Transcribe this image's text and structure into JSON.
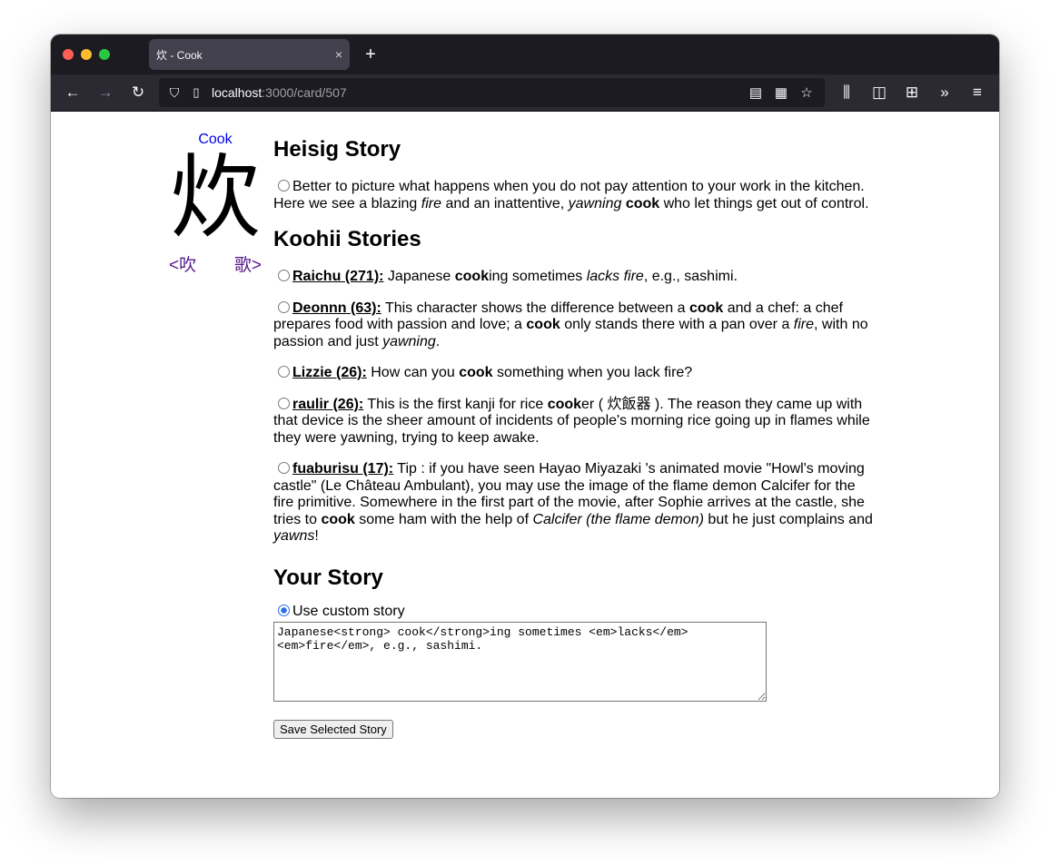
{
  "browser": {
    "tab_title": "炊 - Cook",
    "tab_close": "×",
    "new_tab": "+",
    "url_host": "localhost",
    "url_path": ":3000/card/507",
    "icons": {
      "back": "←",
      "forward": "→",
      "reload": "↻",
      "shield": "⛉",
      "page": "▯",
      "reader": "▤",
      "qr": "▦",
      "bookmark": "☆",
      "library": "⫼",
      "sidebar": "◫",
      "extensions": "⊞",
      "overflow": "»",
      "menu": "≡"
    }
  },
  "card": {
    "keyword": "Cook",
    "kanji": "炊",
    "prev_label": "<吹",
    "next_label": "歌>"
  },
  "heisig": {
    "heading": "Heisig Story",
    "story_parts": [
      {
        "t": "Better to picture what happens when you do not pay attention to your work in the kitchen. Here we see a blazing "
      },
      {
        "t": "fire",
        "em": true
      },
      {
        "t": " and an inattentive, "
      },
      {
        "t": "yawning",
        "em": true
      },
      {
        "t": " "
      },
      {
        "t": "cook",
        "strong": true
      },
      {
        "t": " who let things get out of control."
      }
    ]
  },
  "koohii": {
    "heading": "Koohii Stories",
    "stories": [
      {
        "author": "Raichu (271):",
        "parts": [
          {
            "t": " Japanese "
          },
          {
            "t": "cook",
            "strong": true
          },
          {
            "t": "ing sometimes "
          },
          {
            "t": "lacks fire",
            "em": true
          },
          {
            "t": ", e.g., sashimi."
          }
        ]
      },
      {
        "author": "Deonnn (63):",
        "parts": [
          {
            "t": " This character shows the difference between a "
          },
          {
            "t": "cook",
            "strong": true
          },
          {
            "t": " and a chef: a chef prepares food with passion and love; a "
          },
          {
            "t": "cook",
            "strong": true
          },
          {
            "t": " only stands there with a pan over a "
          },
          {
            "t": "fire",
            "em": true
          },
          {
            "t": ", with no passion and just "
          },
          {
            "t": "yawning",
            "em": true
          },
          {
            "t": "."
          }
        ]
      },
      {
        "author": "Lizzie (26):",
        "parts": [
          {
            "t": " How can you "
          },
          {
            "t": "cook",
            "strong": true
          },
          {
            "t": " something when you lack fire?"
          }
        ]
      },
      {
        "author": "raulir (26):",
        "parts": [
          {
            "t": " This is the first kanji for rice "
          },
          {
            "t": "cook",
            "strong": true
          },
          {
            "t": "er ( 炊飯器 ). The reason they came up with that device is the sheer amount of incidents of people's morning rice going up in flames while they were yawning, trying to keep awake."
          }
        ]
      },
      {
        "author": "fuaburisu (17):",
        "parts": [
          {
            "t": " Tip : if you have seen Hayao Miyazaki 's animated movie \"Howl's moving castle\" (Le Château Ambulant), you may use the image of the flame demon Calcifer for the fire primitive. Somewhere in the first part of the movie, after Sophie arrives at the castle, she tries to "
          },
          {
            "t": "cook",
            "strong": true
          },
          {
            "t": " some ham with the help of "
          },
          {
            "t": "Calcifer (the flame demon)",
            "em": true
          },
          {
            "t": " but he just complains and "
          },
          {
            "t": "yawns",
            "em": true
          },
          {
            "t": "!"
          }
        ]
      }
    ]
  },
  "your_story": {
    "heading": "Your Story",
    "custom_label": "Use custom story",
    "custom_selected": true,
    "textarea_value": "Japanese<strong> cook</strong>ing sometimes <em>lacks</em>\n<em>fire</em>, e.g., sashimi.",
    "save_label": "Save Selected Story"
  }
}
